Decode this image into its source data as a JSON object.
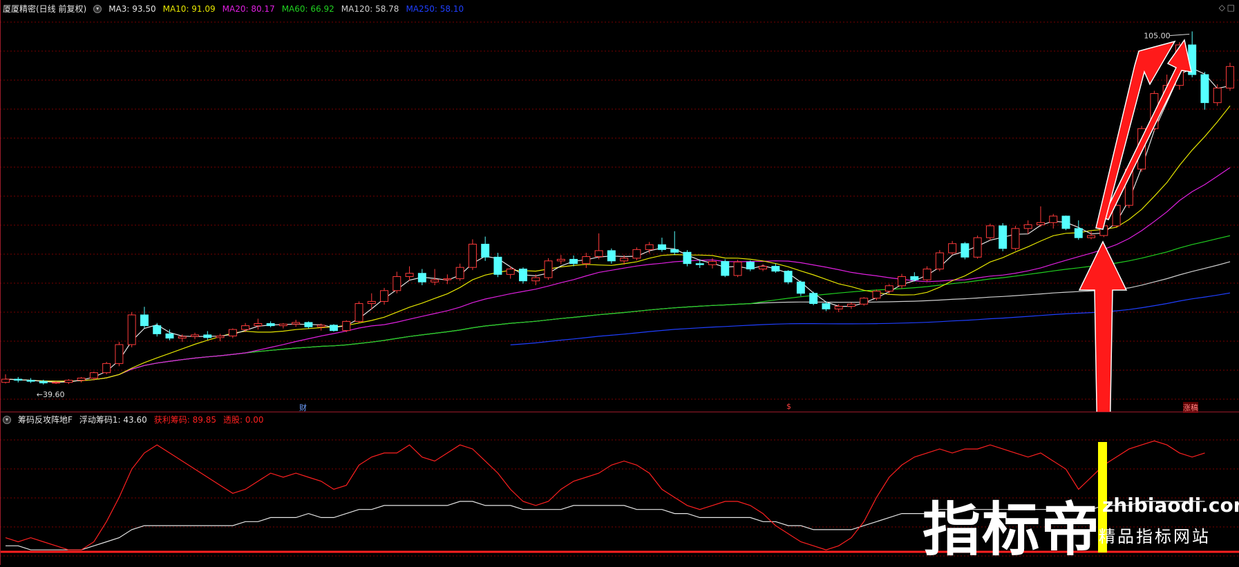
{
  "main": {
    "title": "厦厦精密(日线 前复权)",
    "ma_items": [
      {
        "label": "MA3: 93.50",
        "color": "#e6e6e6"
      },
      {
        "label": "MA10: 91.09",
        "color": "#e6e600"
      },
      {
        "label": "MA20: 80.17",
        "color": "#e020e0"
      },
      {
        "label": "MA60: 66.92",
        "color": "#20d020"
      },
      {
        "label": "MA120: 58.78",
        "color": "#cfcfcf"
      },
      {
        "label": "MA250: 58.10",
        "color": "#1f3fff"
      }
    ],
    "high_label": "105.00",
    "low_label": "39.60",
    "markers": [
      {
        "text": "财",
        "color": "#6fa0ff"
      },
      {
        "text": "$",
        "color": "#ff4040"
      },
      {
        "text": "涨稿",
        "color": "#ff8080"
      }
    ],
    "corner_icons": [
      "◇",
      "□"
    ]
  },
  "sub": {
    "title": "筹码反攻阵地F",
    "items": [
      {
        "label": "浮动筹码1: 43.60",
        "color": "#e6e6e6"
      },
      {
        "label": "获利筹码: 89.85",
        "color": "#ff2020"
      },
      {
        "label": "透股: 0.00",
        "color": "#ff2020"
      }
    ]
  },
  "watermark": {
    "cn": "指标帝",
    "en": "zhibiaodi.com",
    "sub": "精品指标网站"
  },
  "colors": {
    "up": "#ff3b3b",
    "down": "#55ffff",
    "grid": "#7a0000",
    "arrow": "#ff1a1a",
    "signal": "#ffff00"
  },
  "chart_data": {
    "type": "candlestick",
    "ohlc": [
      [
        40.0,
        41.5,
        39.8,
        40.6
      ],
      [
        40.6,
        41.0,
        40.0,
        40.4
      ],
      [
        40.4,
        40.8,
        39.9,
        40.2
      ],
      [
        40.2,
        40.5,
        39.6,
        39.9
      ],
      [
        39.9,
        40.2,
        39.7,
        40.0
      ],
      [
        40.0,
        40.6,
        39.7,
        40.4
      ],
      [
        40.4,
        41.0,
        40.0,
        40.8
      ],
      [
        40.8,
        42.0,
        40.4,
        41.8
      ],
      [
        41.8,
        43.8,
        41.5,
        43.5
      ],
      [
        43.5,
        47.5,
        43.0,
        47.0
      ],
      [
        47.0,
        53.0,
        46.5,
        52.5
      ],
      [
        52.5,
        54.0,
        50.0,
        50.5
      ],
      [
        50.5,
        51.0,
        48.5,
        49.0
      ],
      [
        49.0,
        49.8,
        47.8,
        48.2
      ],
      [
        48.2,
        48.9,
        47.5,
        48.5
      ],
      [
        48.5,
        49.2,
        48.0,
        48.8
      ],
      [
        48.8,
        49.5,
        47.9,
        48.3
      ],
      [
        48.3,
        49.0,
        47.6,
        48.6
      ],
      [
        48.6,
        50.0,
        48.2,
        49.8
      ],
      [
        49.8,
        51.0,
        49.3,
        50.5
      ],
      [
        50.5,
        51.8,
        49.8,
        50.9
      ],
      [
        50.9,
        51.3,
        50.2,
        50.5
      ],
      [
        50.5,
        51.0,
        50.0,
        50.8
      ],
      [
        50.8,
        51.6,
        50.3,
        51.1
      ],
      [
        51.1,
        51.3,
        50.0,
        50.3
      ],
      [
        50.3,
        50.9,
        49.6,
        50.6
      ],
      [
        50.6,
        50.8,
        49.4,
        49.6
      ],
      [
        49.6,
        51.5,
        49.3,
        51.3
      ],
      [
        51.3,
        55.0,
        51.0,
        54.6
      ],
      [
        54.6,
        56.5,
        53.5,
        55.0
      ],
      [
        55.0,
        57.5,
        54.4,
        57.0
      ],
      [
        57.0,
        60.5,
        56.5,
        59.6
      ],
      [
        59.6,
        61.5,
        58.8,
        60.2
      ],
      [
        60.2,
        61.0,
        58.0,
        58.6
      ],
      [
        58.6,
        61.0,
        58.0,
        59.0
      ],
      [
        59.0,
        60.0,
        58.2,
        59.2
      ],
      [
        59.2,
        62.0,
        58.8,
        61.3
      ],
      [
        61.3,
        66.5,
        60.8,
        65.6
      ],
      [
        65.6,
        67.0,
        62.5,
        63.2
      ],
      [
        63.2,
        64.0,
        59.5,
        60.0
      ],
      [
        60.0,
        61.5,
        59.2,
        61.0
      ],
      [
        61.0,
        61.3,
        58.3,
        58.8
      ],
      [
        58.8,
        60.0,
        58.0,
        59.4
      ],
      [
        59.4,
        63.0,
        59.0,
        62.5
      ],
      [
        62.5,
        63.6,
        61.9,
        62.8
      ],
      [
        62.8,
        63.5,
        61.5,
        62.0
      ],
      [
        62.0,
        64.0,
        61.2,
        63.3
      ],
      [
        63.3,
        67.6,
        62.8,
        64.4
      ],
      [
        64.4,
        64.8,
        62.0,
        62.5
      ],
      [
        62.5,
        63.6,
        61.8,
        63.0
      ],
      [
        63.0,
        65.0,
        62.6,
        64.6
      ],
      [
        64.6,
        66.0,
        63.9,
        65.5
      ],
      [
        65.5,
        66.8,
        64.2,
        64.6
      ],
      [
        64.6,
        68.0,
        63.6,
        64.1
      ],
      [
        64.1,
        64.5,
        61.5,
        62.0
      ],
      [
        62.0,
        62.8,
        61.2,
        61.8
      ],
      [
        61.8,
        63.0,
        61.1,
        62.4
      ],
      [
        62.4,
        62.8,
        59.5,
        59.8
      ],
      [
        59.8,
        62.7,
        59.5,
        62.3
      ],
      [
        62.3,
        62.6,
        60.6,
        61.0
      ],
      [
        61.0,
        61.9,
        60.6,
        61.5
      ],
      [
        61.5,
        62.0,
        60.3,
        60.6
      ],
      [
        60.6,
        60.8,
        58.2,
        58.6
      ],
      [
        58.6,
        58.9,
        56.0,
        56.5
      ],
      [
        56.5,
        56.8,
        54.3,
        54.6
      ],
      [
        54.6,
        55.0,
        53.2,
        53.6
      ],
      [
        53.6,
        54.5,
        53.0,
        54.1
      ],
      [
        54.1,
        54.8,
        53.6,
        54.5
      ],
      [
        54.5,
        55.8,
        54.2,
        55.6
      ],
      [
        55.6,
        57.2,
        55.2,
        56.9
      ],
      [
        56.9,
        58.2,
        56.4,
        57.9
      ],
      [
        57.9,
        60.1,
        57.4,
        59.6
      ],
      [
        59.6,
        60.4,
        58.7,
        59.0
      ],
      [
        59.0,
        61.5,
        58.7,
        61.0
      ],
      [
        61.0,
        64.5,
        60.6,
        64.0
      ],
      [
        64.0,
        66.2,
        63.6,
        65.7
      ],
      [
        65.7,
        66.0,
        62.8,
        63.2
      ],
      [
        63.2,
        67.2,
        62.9,
        66.8
      ],
      [
        66.8,
        69.4,
        66.3,
        69.0
      ],
      [
        69.0,
        69.5,
        64.3,
        64.8
      ],
      [
        64.8,
        69.0,
        64.4,
        68.5
      ],
      [
        68.5,
        70.0,
        67.5,
        69.2
      ],
      [
        69.2,
        72.6,
        68.8,
        69.6
      ],
      [
        69.6,
        71.2,
        68.5,
        70.8
      ],
      [
        70.8,
        70.9,
        68.2,
        68.5
      ],
      [
        68.5,
        70.0,
        66.4,
        66.8
      ],
      [
        66.8,
        68.0,
        66.5,
        67.2
      ],
      [
        67.2,
        69.6,
        66.9,
        69.0
      ],
      [
        69.0,
        73.6,
        68.8,
        72.8
      ],
      [
        72.8,
        80.0,
        72.3,
        79.5
      ],
      [
        79.5,
        87.5,
        79.0,
        87.0
      ],
      [
        87.0,
        94.0,
        86.5,
        93.5
      ],
      [
        93.5,
        97.0,
        92.5,
        95.0
      ],
      [
        95.0,
        103.0,
        94.2,
        102.5
      ],
      [
        102.5,
        105.0,
        96.5,
        97.0
      ],
      [
        97.0,
        97.5,
        90.5,
        91.8
      ],
      [
        91.8,
        95.2,
        91.2,
        94.5
      ],
      [
        94.5,
        99.2,
        94.0,
        98.5
      ]
    ],
    "sub_series": {
      "profit_chip": [
        14,
        13,
        14,
        13,
        12,
        11,
        11,
        13,
        18,
        24,
        31,
        35,
        37,
        35,
        33,
        31,
        29,
        27,
        25,
        26,
        28,
        30,
        29,
        30,
        29,
        28,
        26,
        27,
        32,
        34,
        35,
        35,
        37,
        34,
        33,
        35,
        37,
        36,
        33,
        30,
        26,
        23,
        22,
        23,
        26,
        28,
        29,
        30,
        32,
        33,
        32,
        30,
        26,
        24,
        22,
        21,
        22,
        23,
        23,
        22,
        20,
        17,
        15,
        13,
        12,
        11,
        12,
        14,
        18,
        24,
        29,
        32,
        34,
        35,
        36,
        35,
        36,
        36,
        37,
        36,
        35,
        34,
        35,
        33,
        31,
        26,
        29,
        32,
        34,
        36,
        37,
        38,
        37,
        35,
        34,
        35
      ],
      "float_chip": [
        12,
        12,
        11,
        11,
        11,
        11,
        11,
        12,
        13,
        14,
        16,
        17,
        17,
        17,
        17,
        17,
        17,
        17,
        17,
        18,
        18,
        19,
        19,
        19,
        20,
        19,
        19,
        20,
        21,
        21,
        22,
        22,
        22,
        22,
        22,
        22,
        23,
        23,
        22,
        22,
        22,
        21,
        21,
        21,
        21,
        22,
        22,
        22,
        22,
        22,
        21,
        21,
        21,
        20,
        20,
        19,
        19,
        19,
        19,
        19,
        18,
        18,
        17,
        17,
        16,
        16,
        16,
        16,
        17,
        18,
        19,
        20,
        20,
        20,
        21,
        21,
        21,
        21,
        21,
        21,
        21,
        21,
        21,
        21,
        21,
        21,
        21,
        22,
        22,
        22,
        23,
        23,
        23,
        23,
        23,
        23
      ],
      "ylim": [
        10,
        42
      ]
    },
    "ylim": [
      36,
      108
    ]
  }
}
